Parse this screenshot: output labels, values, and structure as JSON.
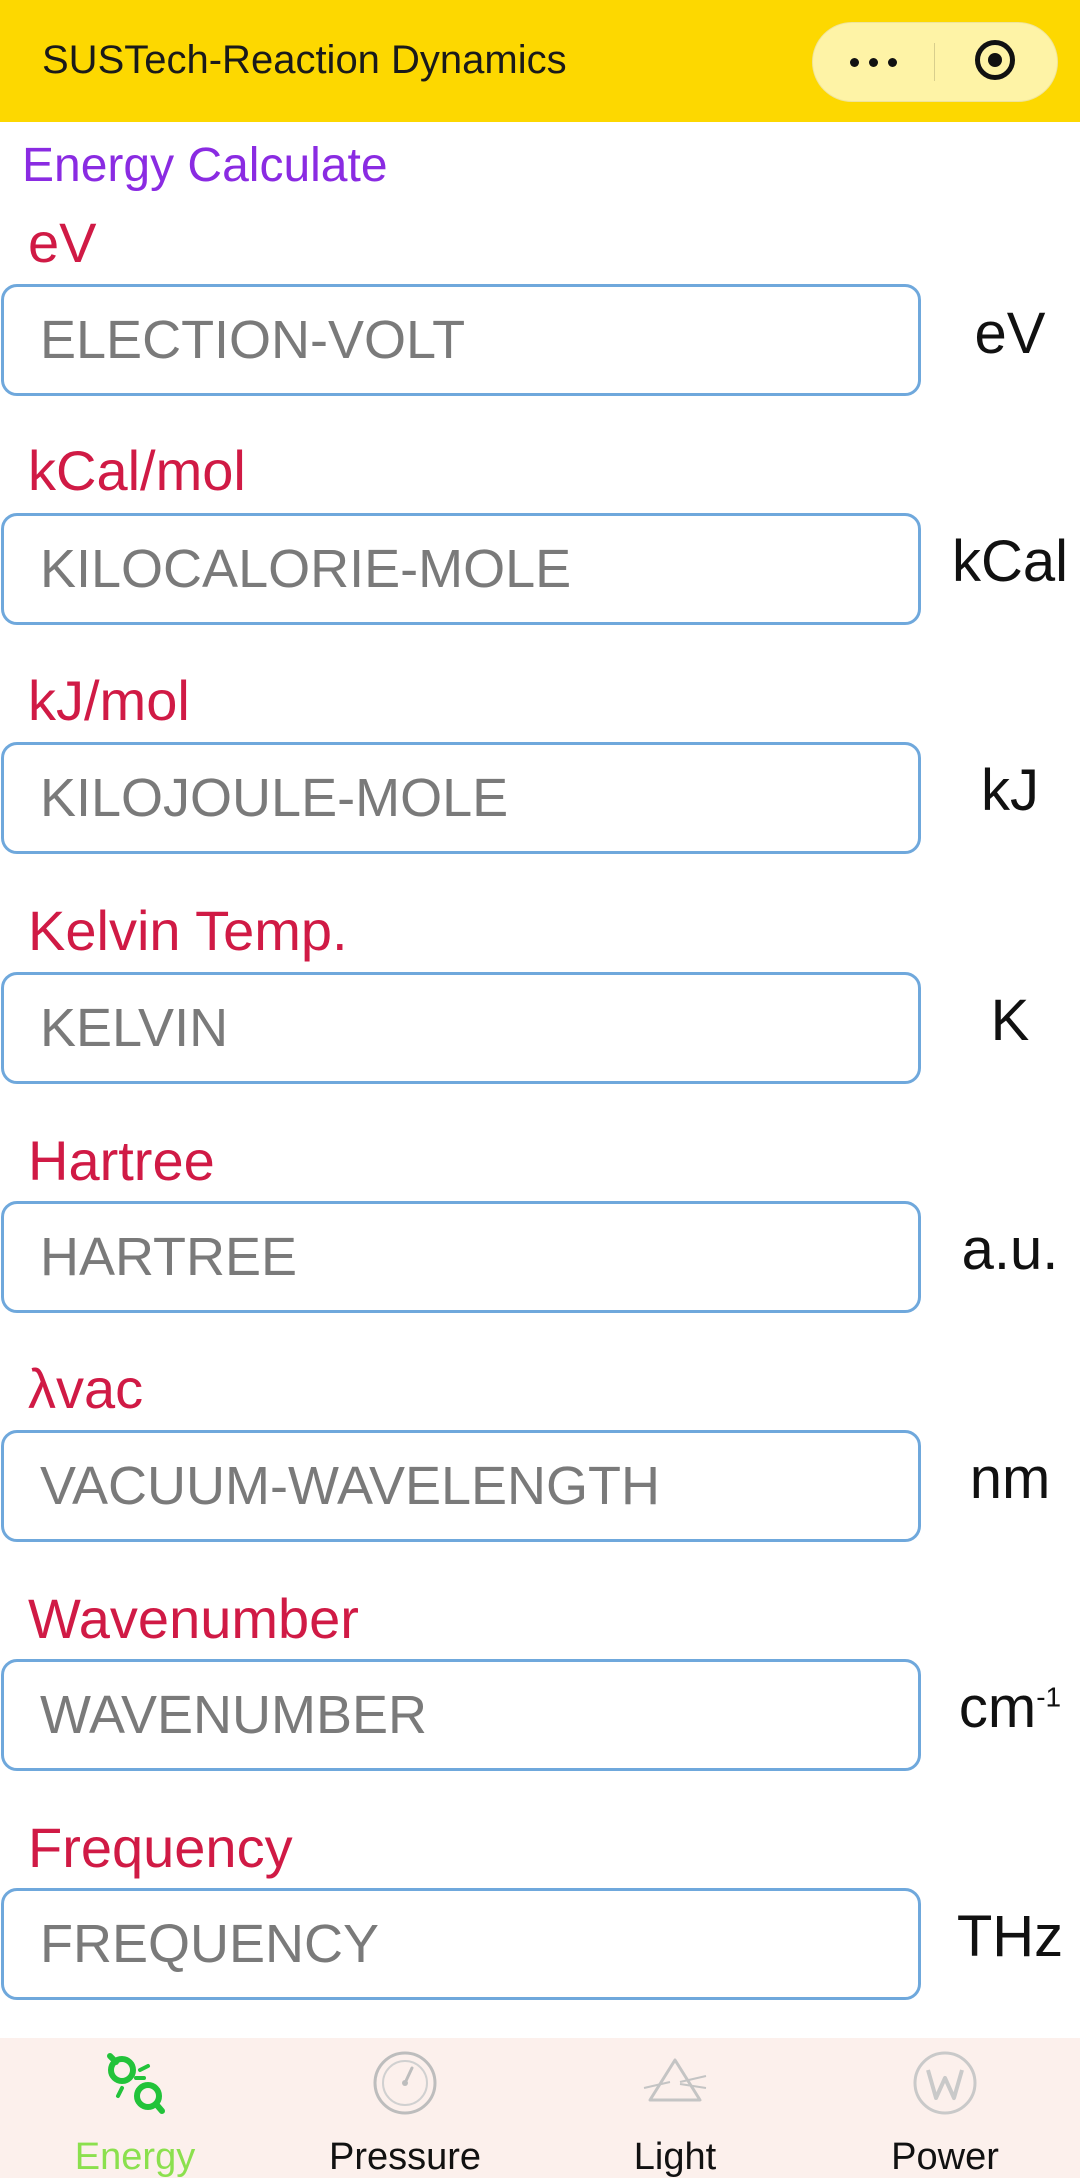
{
  "header": {
    "title": "SUSTech-Reaction Dynamics"
  },
  "capsule": {
    "more_icon": "more-dots-icon",
    "close_icon": "target-icon"
  },
  "page": {
    "title": "Energy Calculate"
  },
  "fields": [
    {
      "label": "eV",
      "placeholder": "ELECTION-VOLT",
      "value": "",
      "unit": "eV"
    },
    {
      "label": "kCal/mol",
      "placeholder": "KILOCALORIE-MOLE",
      "value": "",
      "unit": "kCal"
    },
    {
      "label": "kJ/mol",
      "placeholder": "KILOJOULE-MOLE",
      "value": "",
      "unit": "kJ"
    },
    {
      "label": "Kelvin Temp.",
      "placeholder": "KELVIN",
      "value": "",
      "unit": "K"
    },
    {
      "label": "Hartree",
      "placeholder": "HARTREE",
      "value": "",
      "unit": "a.u."
    },
    {
      "label": "λvac",
      "placeholder": "VACUUM-WAVELENGTH",
      "value": "",
      "unit": "nm"
    },
    {
      "label": "Wavenumber",
      "placeholder": "WAVENUMBER",
      "value": "",
      "unit": "cm",
      "unit_sup": "-1"
    },
    {
      "label": "Frequency",
      "placeholder": "FREQUENCY",
      "value": "",
      "unit": "THz"
    }
  ],
  "tabbar": {
    "tabs": [
      {
        "label": "Energy",
        "icon": "energy-icon",
        "active": true
      },
      {
        "label": "Pressure",
        "icon": "pressure-gauge-icon",
        "active": false
      },
      {
        "label": "Light",
        "icon": "prism-icon",
        "active": false
      },
      {
        "label": "Power",
        "icon": "watt-icon",
        "active": false
      }
    ]
  },
  "colors": {
    "header_bg": "#FDD800",
    "title_purple": "#8A2BE2",
    "label_red": "#D01A45",
    "input_border": "#6FA8DC",
    "tab_active": "#8BE04E",
    "tabbar_bg": "#FCF0EC"
  }
}
